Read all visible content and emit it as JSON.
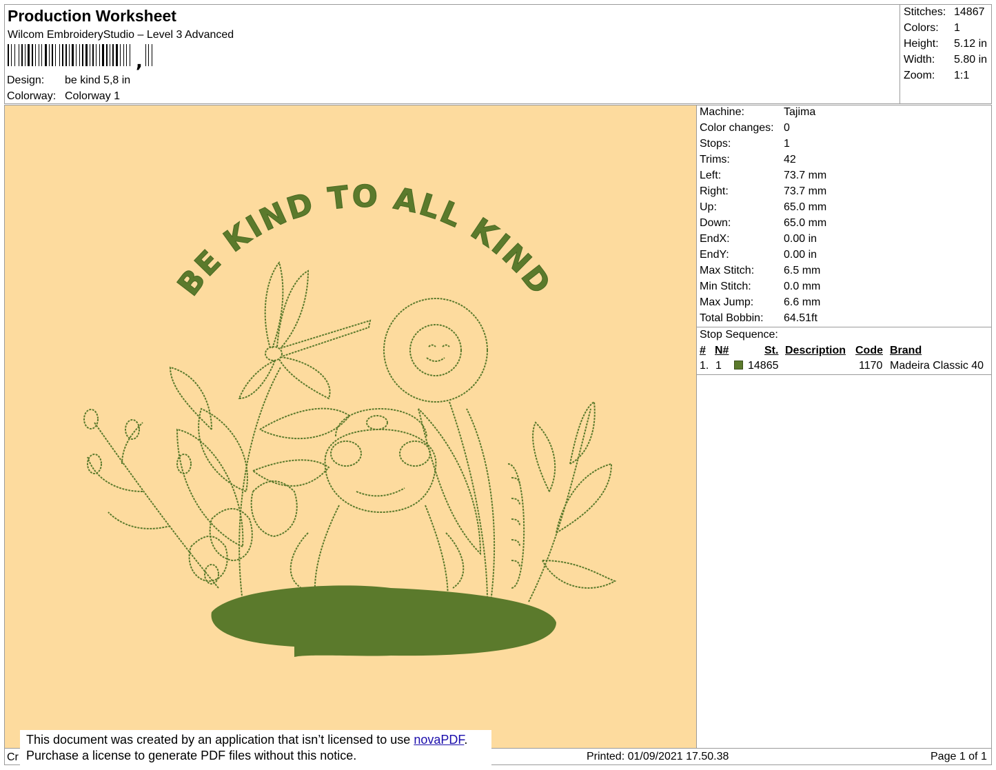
{
  "header": {
    "title": "Production Worksheet",
    "subtitle": "Wilcom EmbroideryStudio – Level 3 Advanced",
    "design_label": "Design:",
    "design_value": "be kind 5,8 in",
    "colorway_label": "Colorway:",
    "colorway_value": "Colorway 1"
  },
  "stats": [
    {
      "label": "Stitches:",
      "value": "14867"
    },
    {
      "label": "Colors:",
      "value": "1"
    },
    {
      "label": "Height:",
      "value": "5.12 in"
    },
    {
      "label": "Width:",
      "value": "5.80 in"
    },
    {
      "label": "Zoom:",
      "value": "1:1"
    }
  ],
  "machine_info": [
    {
      "label": "Machine:",
      "value": "Tajima"
    },
    {
      "label": "Color changes:",
      "value": "0"
    },
    {
      "label": "Stops:",
      "value": "1"
    },
    {
      "label": "Trims:",
      "value": "42"
    },
    {
      "label": "Left:",
      "value": "73.7 mm"
    },
    {
      "label": "Right:",
      "value": "73.7 mm"
    },
    {
      "label": "Up:",
      "value": "65.0 mm"
    },
    {
      "label": "Down:",
      "value": "65.0 mm"
    },
    {
      "label": "EndX:",
      "value": "0.00 in"
    },
    {
      "label": "EndY:",
      "value": "0.00 in"
    },
    {
      "label": "Max Stitch:",
      "value": "6.5 mm"
    },
    {
      "label": "Min Stitch:",
      "value": "0.0 mm"
    },
    {
      "label": "Max Jump:",
      "value": "6.6 mm"
    },
    {
      "label": "Total Bobbin:",
      "value": "64.51ft"
    }
  ],
  "stop_sequence": {
    "title": "Stop Sequence:",
    "headers": {
      "num": "#",
      "n": "N#",
      "st": "St.",
      "desc": "Description",
      "code": "Code",
      "brand": "Brand"
    },
    "rows": [
      {
        "num": "1.",
        "n": "1",
        "st": "14865",
        "desc": "",
        "code": "1170",
        "brand": "Madeira Classic 40",
        "color": "#5b7a2c"
      }
    ]
  },
  "design_art": {
    "arc_text": "BE KIND TO ALL KIND",
    "background": "#fddb9e",
    "thread_color": "#5b7a2c"
  },
  "footer": {
    "left_fragment": "Cr",
    "printed": "Printed: 01/09/2021 17.50.38",
    "page": "Page 1 of 1"
  },
  "notice": {
    "line1_prefix": "This document was created by an application that isn’t licensed to use ",
    "link": "novaPDF",
    "line1_suffix": ".",
    "line2": "Purchase a license to generate PDF files without this notice."
  }
}
